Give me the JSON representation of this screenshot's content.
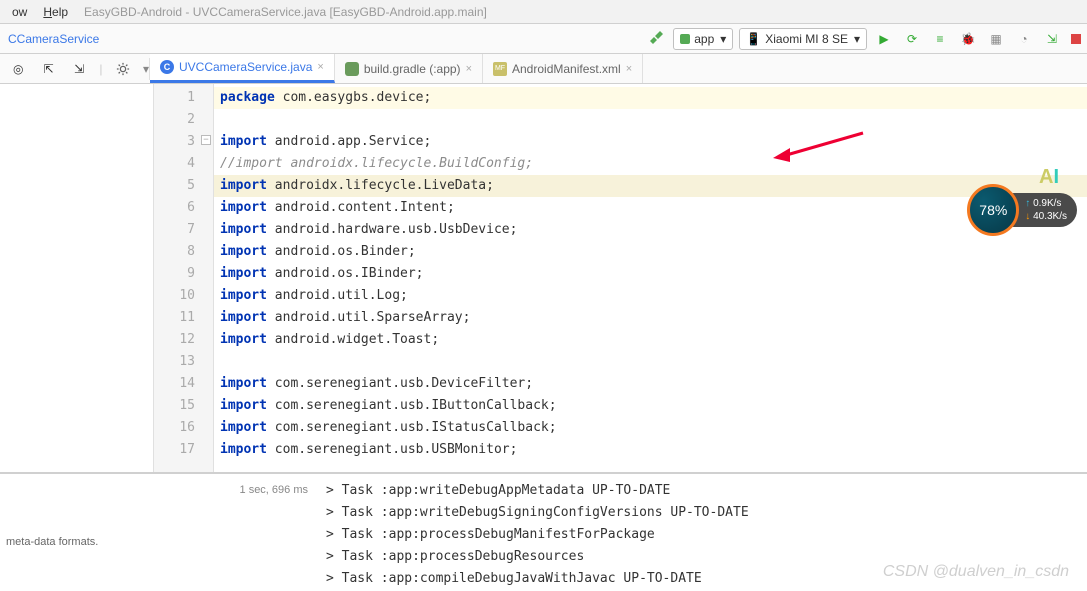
{
  "menubar": {
    "items": [
      "ow",
      "Help"
    ],
    "title": "EasyGBD-Android - UVCCameraService.java [EasyGBD-Android.app.main]"
  },
  "crumbs": {
    "path": "CCameraService"
  },
  "run": {
    "config_label": "app",
    "device_label": "Xiaomi MI 8 SE"
  },
  "tabs": [
    {
      "label": "UVCCameraService.java",
      "icon": "c",
      "active": true
    },
    {
      "label": "build.gradle (:app)",
      "icon": "elephant",
      "active": false
    },
    {
      "label": "AndroidManifest.xml",
      "icon": "mf",
      "active": false
    }
  ],
  "code": {
    "lines": [
      {
        "n": 1,
        "kw": "package",
        "txt": " com.easygbs.device;",
        "hl": "hl1"
      },
      {
        "n": 2,
        "kw": "",
        "txt": "",
        "hl": ""
      },
      {
        "n": 3,
        "kw": "import",
        "txt": " android.app.Service;",
        "hl": "",
        "fold": true
      },
      {
        "n": 4,
        "kw": "",
        "txt": "//import androidx.lifecycle.BuildConfig;",
        "hl": "",
        "comment": true
      },
      {
        "n": 5,
        "kw": "import",
        "txt": " androidx.lifecycle.LiveData;",
        "hl": "hl2"
      },
      {
        "n": 6,
        "kw": "import",
        "txt": " android.content.Intent;",
        "hl": ""
      },
      {
        "n": 7,
        "kw": "import",
        "txt": " android.hardware.usb.UsbDevice;",
        "hl": ""
      },
      {
        "n": 8,
        "kw": "import",
        "txt": " android.os.Binder;",
        "hl": ""
      },
      {
        "n": 9,
        "kw": "import",
        "txt": " android.os.IBinder;",
        "hl": ""
      },
      {
        "n": 10,
        "kw": "import",
        "txt": " android.util.Log;",
        "hl": ""
      },
      {
        "n": 11,
        "kw": "import",
        "txt": " android.util.SparseArray;",
        "hl": ""
      },
      {
        "n": 12,
        "kw": "import",
        "txt": " android.widget.Toast;",
        "hl": ""
      },
      {
        "n": 13,
        "kw": "",
        "txt": "",
        "hl": ""
      },
      {
        "n": 14,
        "kw": "import",
        "txt": " com.serenegiant.usb.DeviceFilter;",
        "hl": ""
      },
      {
        "n": 15,
        "kw": "import",
        "txt": " com.serenegiant.usb.IButtonCallback;",
        "hl": ""
      },
      {
        "n": 16,
        "kw": "import",
        "txt": " com.serenegiant.usb.IStatusCallback;",
        "hl": ""
      },
      {
        "n": 17,
        "kw": "import",
        "txt": " com.serenegiant.usb.USBMonitor;",
        "hl": ""
      }
    ]
  },
  "overlay": {
    "percent": "78%",
    "upload": "0.9K/s",
    "download": "40.3K/s",
    "ai": {
      "a": "A",
      "i": "I"
    }
  },
  "bottom": {
    "timing": "1 sec, 696 ms",
    "meta": "meta-data formats.",
    "lines": [
      "> Task :app:writeDebugAppMetadata UP-TO-DATE",
      "> Task :app:writeDebugSigningConfigVersions UP-TO-DATE",
      "> Task :app:processDebugManifestForPackage",
      "> Task :app:processDebugResources",
      "> Task :app:compileDebugJavaWithJavac UP-TO-DATE"
    ]
  },
  "watermark": "CSDN @dualven_in_csdn"
}
